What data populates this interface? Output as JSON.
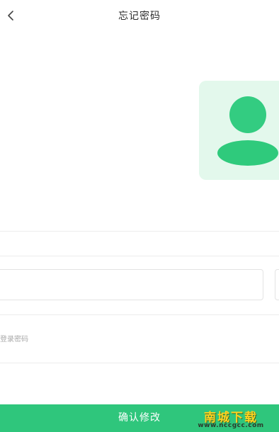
{
  "header": {
    "back_icon": "chevron-left-icon",
    "title": "忘记密码"
  },
  "avatar": {
    "icon": "user-avatar-icon",
    "card_color": "#e3f8ec",
    "figure_color": "#33cc81"
  },
  "form": {
    "verification_code": {
      "value": "",
      "placeholder": ""
    },
    "new_password": {
      "value": "",
      "placeholder": "登录密码"
    }
  },
  "actions": {
    "confirm_label": "确认修改",
    "confirm_color": "#2fc67c"
  },
  "watermark": {
    "main": "南城下载",
    "url": "www.nccgcc.com"
  }
}
